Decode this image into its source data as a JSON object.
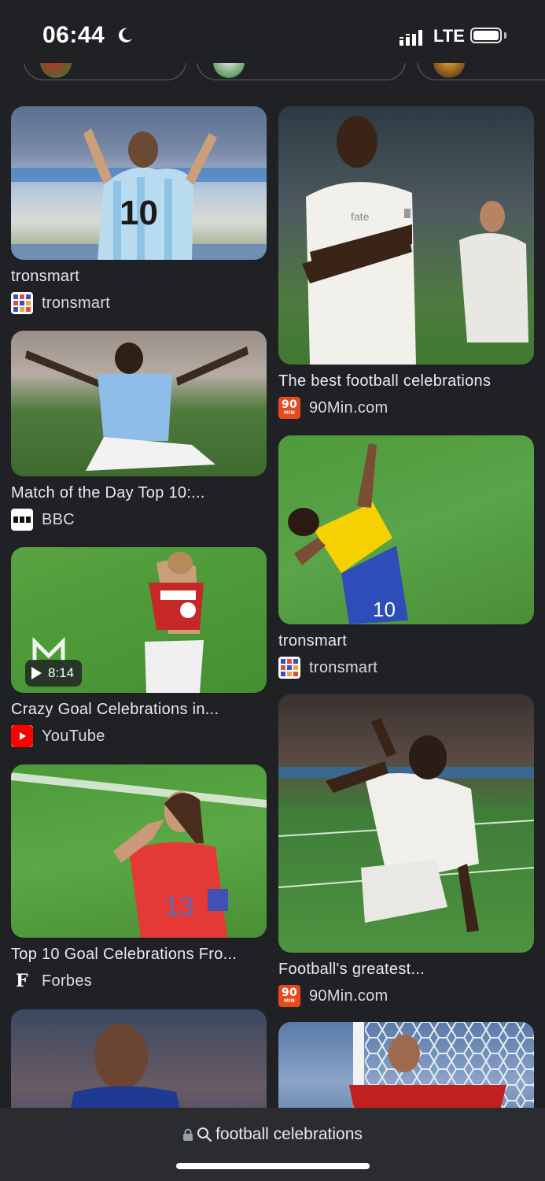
{
  "status_bar": {
    "time": "06:44",
    "network": "LTE"
  },
  "results": [
    {
      "title": "tronsmart",
      "source": "tronsmart",
      "favicon": "tronsmart-grid-icon"
    },
    {
      "title": "The best football celebrations",
      "source": "90Min.com",
      "favicon": "90min-logo-icon"
    },
    {
      "title": "Match of the Day Top 10:...",
      "source": "BBC",
      "favicon": "bbc-logo-icon"
    },
    {
      "title": "tronsmart",
      "source": "tronsmart",
      "favicon": "tronsmart-grid-icon"
    },
    {
      "title": "Crazy Goal Celebrations in...",
      "source": "YouTube",
      "favicon": "youtube-logo-icon",
      "duration": "8:14"
    },
    {
      "title": "Football's greatest...",
      "source": "90Min.com",
      "favicon": "90min-logo-icon"
    },
    {
      "title": "Top 10 Goal Celebrations Fro...",
      "source": "Forbes",
      "favicon": "forbes-logo-icon"
    }
  ],
  "address_bar": {
    "text": "football celebrations"
  },
  "colors": {
    "background": "#202124",
    "text": "#e8eaed",
    "youtube": "#ff0000",
    "ninety_min": "#e8491d"
  }
}
